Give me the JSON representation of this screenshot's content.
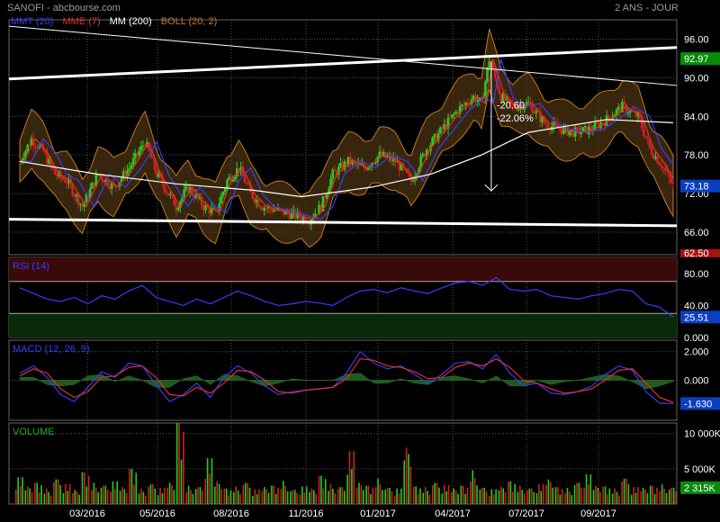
{
  "header": {
    "title": "SANOFI - abcbourse.com",
    "period": "2 ANS - JOUR"
  },
  "legend": [
    {
      "label": "MMT (20)",
      "color": "#3a3aff"
    },
    {
      "label": "MME (7)",
      "color": "#e03030"
    },
    {
      "label": "MM (200)",
      "color": "#ffffff"
    },
    {
      "label": "BOLL (20, 2)",
      "color": "#c07a20"
    }
  ],
  "chart_data": [
    {
      "type": "candlestick",
      "panel": "price",
      "ylim": [
        62.5,
        99
      ],
      "y_ticks": [
        "96.00",
        "90.00",
        "84.00",
        "78.00",
        "72.00",
        "66.00"
      ],
      "y_tick_values": [
        96,
        90,
        84,
        78,
        72,
        66
      ],
      "bottom_label": "62.50",
      "last_price": "73.18",
      "high_marker": "92.97",
      "annotation": [
        "-20.60",
        "-22.06%"
      ],
      "x_ticks": [
        "03/2016",
        "05/2016",
        "08/2016",
        "11/2016",
        "01/2017",
        "04/2017",
        "07/2017",
        "09/2017"
      ],
      "series": [
        {
          "name": "MMT (20)",
          "color": "#3a3aff"
        },
        {
          "name": "MME (7)",
          "color": "#e03030"
        },
        {
          "name": "MM (200)",
          "color": "#ffffff"
        },
        {
          "name": "BOLL (20, 2)",
          "color": "#c07a20"
        }
      ],
      "close_path": [
        [
          0,
          77.0
        ],
        [
          3,
          80.5
        ],
        [
          6,
          78.5
        ],
        [
          9,
          75.0
        ],
        [
          12,
          74.0
        ],
        [
          16,
          70.0
        ],
        [
          20,
          75.0
        ],
        [
          24,
          73.0
        ],
        [
          28,
          76.0
        ],
        [
          32,
          80.0
        ],
        [
          35,
          75.0
        ],
        [
          40,
          70.0
        ],
        [
          43,
          73.0
        ],
        [
          47,
          70.0
        ],
        [
          50,
          69.0
        ],
        [
          53,
          74.0
        ],
        [
          56,
          76.0
        ],
        [
          59,
          72.0
        ],
        [
          62,
          70.0
        ],
        [
          65,
          69.5
        ],
        [
          68,
          69.0
        ],
        [
          71,
          68.5
        ],
        [
          74,
          68.0
        ],
        [
          77,
          70.0
        ],
        [
          80,
          75.0
        ],
        [
          84,
          77.0
        ],
        [
          88,
          76.0
        ],
        [
          92,
          78.0
        ],
        [
          96,
          77.0
        ],
        [
          100,
          74.0
        ],
        [
          104,
          79.0
        ],
        [
          108,
          82.0
        ],
        [
          112,
          85.0
        ],
        [
          116,
          87.0
        ],
        [
          118,
          86.0
        ],
        [
          120,
          92.9
        ],
        [
          123,
          87.0
        ],
        [
          126,
          85.5
        ],
        [
          130,
          86.0
        ],
        [
          134,
          83.0
        ],
        [
          138,
          82.0
        ],
        [
          142,
          81.5
        ],
        [
          146,
          82.0
        ],
        [
          150,
          83.5
        ],
        [
          154,
          85.5
        ],
        [
          158,
          84.0
        ],
        [
          161,
          79.0
        ],
        [
          164,
          76.5
        ],
        [
          167,
          73.18
        ]
      ],
      "trendlines": [
        {
          "from": [
            0,
            89.8
          ],
          "to": [
            167,
            94.7
          ],
          "color": "#ffffff",
          "width": 3
        },
        {
          "from": [
            0,
            68.0
          ],
          "to": [
            167,
            67.0
          ],
          "color": "#ffffff",
          "width": 3
        },
        {
          "from": [
            0,
            98.0
          ],
          "to": [
            167,
            88.8
          ],
          "color": "#ffffff",
          "width": 1
        }
      ],
      "mm200_path": [
        [
          0,
          77.0
        ],
        [
          20,
          75.0
        ],
        [
          40,
          73.5
        ],
        [
          60,
          72.5
        ],
        [
          72,
          71.5
        ],
        [
          90,
          73.0
        ],
        [
          105,
          75.0
        ],
        [
          118,
          78.0
        ],
        [
          130,
          81.5
        ],
        [
          150,
          83.5
        ],
        [
          167,
          83.0
        ]
      ]
    },
    {
      "type": "line",
      "panel": "rsi",
      "label": "RSI (14)",
      "ylim": [
        0,
        100
      ],
      "y_ticks": [
        "80.00",
        "40.00",
        "0.000"
      ],
      "y_tick_values": [
        80,
        40,
        0
      ],
      "last_value": "25.51",
      "bands": [
        70,
        30
      ],
      "values": [
        62,
        55,
        48,
        45,
        50,
        42,
        52,
        48,
        58,
        65,
        50,
        45,
        40,
        48,
        42,
        50,
        58,
        52,
        45,
        40,
        42,
        45,
        43,
        40,
        50,
        58,
        60,
        56,
        62,
        58,
        55,
        62,
        68,
        70,
        65,
        75,
        60,
        58,
        60,
        52,
        50,
        48,
        52,
        55,
        60,
        58,
        42,
        38,
        25.51
      ]
    },
    {
      "type": "line",
      "panel": "macd",
      "label": "MACD (12, 26, 9)",
      "ylim": [
        -2.8,
        2.8
      ],
      "y_ticks": [
        "2.000",
        "0.000"
      ],
      "y_tick_values": [
        2,
        0
      ],
      "last_value": "-1.630",
      "macd": [
        0.5,
        1.0,
        0.2,
        -1.0,
        -1.5,
        -0.5,
        0.6,
        0.2,
        1.2,
        1.0,
        -0.3,
        -1.5,
        -1.0,
        -0.2,
        -1.2,
        0.2,
        1.0,
        0.5,
        -0.4,
        -1.0,
        -0.8,
        -0.7,
        -0.6,
        -0.5,
        0.5,
        2.0,
        1.2,
        0.8,
        1.0,
        0.4,
        -0.2,
        0.4,
        1.2,
        1.3,
        0.8,
        1.8,
        0.5,
        -0.4,
        -0.2,
        -0.9,
        -1.0,
        -0.8,
        -0.4,
        0.4,
        1.0,
        0.7,
        -0.8,
        -1.6,
        -1.63
      ],
      "signal": [
        0.3,
        0.8,
        0.5,
        -0.6,
        -1.2,
        -0.8,
        0.2,
        0.3,
        0.9,
        1.0,
        0.2,
        -1.0,
        -1.1,
        -0.5,
        -0.9,
        -0.2,
        0.7,
        0.6,
        0.0,
        -0.8,
        -0.9,
        -0.7,
        -0.6,
        -0.5,
        0.1,
        1.5,
        1.4,
        1.0,
        0.9,
        0.6,
        0.1,
        0.2,
        0.9,
        1.2,
        1.0,
        1.5,
        0.9,
        0.0,
        -0.2,
        -0.6,
        -0.9,
        -0.8,
        -0.6,
        0.0,
        0.7,
        0.8,
        -0.2,
        -1.2,
        -1.55
      ]
    },
    {
      "type": "bar",
      "panel": "volume",
      "label": "VOLUME",
      "ylim": [
        0,
        11500
      ],
      "y_ticks": [
        "10 000K",
        "5 000K"
      ],
      "y_tick_values": [
        10000,
        5000
      ],
      "last_value": "2 315K",
      "values": [
        3800,
        2500,
        3000,
        2200,
        3500,
        2800,
        2000,
        4500,
        3000,
        2600,
        3200,
        2400,
        5000,
        2200,
        2800,
        2300,
        3000,
        11500,
        2600,
        2400,
        6500,
        3200,
        2200,
        2500,
        3000,
        2100,
        2400,
        2600,
        3300,
        2000,
        2500,
        2200,
        4000,
        2800,
        2400,
        7500,
        3000,
        2600,
        3600,
        2300,
        2200,
        8000,
        2500,
        2400,
        3000,
        2700,
        2200,
        2600,
        4800,
        2300,
        2100,
        2500,
        3200,
        2600,
        2200,
        2800,
        3500,
        2400,
        2300,
        3000,
        4200,
        2600,
        2500,
        2200,
        3600,
        2400,
        2300,
        2600,
        2800,
        2315
      ]
    }
  ],
  "colors": {
    "background": "#000000",
    "grid": "#555555",
    "axis_text": "#ffffff",
    "up_candle": "#22cc22",
    "down_candle": "#cc2222",
    "bollinger_fill": "#4a3312",
    "last_price_badge": "#0a3fc0",
    "high_badge": "#0a8a0a",
    "bottom_badge": "#aa1111"
  }
}
